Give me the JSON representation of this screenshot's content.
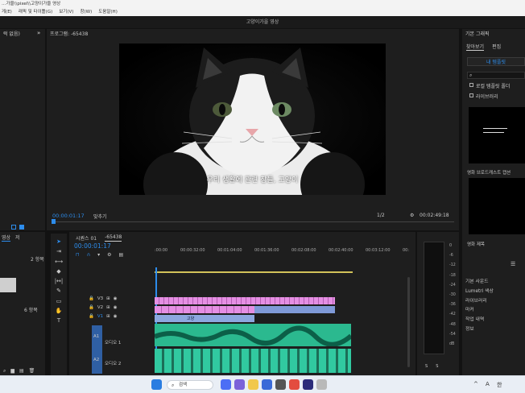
{
  "window": {
    "title": "…가을\\\\pixel\\\\고양이가을 영상"
  },
  "menu": [
    "편집(E)",
    "클립(C)",
    "시퀀스(S)",
    "표식(M)",
    "그래픽 및 타이틀(G)",
    "보기(V)",
    "창(W)",
    "도움말(H)"
  ],
  "menu_visible": [
    "게(E)",
    "래픽 및 타이틀(G)",
    "보기(V)",
    "창(W)",
    "도움말(H)"
  ],
  "app_header": {
    "title": "고양이가을 영상"
  },
  "source_panel": {
    "tab": "럭 없음)"
  },
  "program_monitor": {
    "tab": "프로그램: -65438",
    "subtitle": "우리 생활에 관련 창들, 고양이",
    "timecode_current": "00:00:01:17",
    "fit_label": "맞추기",
    "quality": "1/2",
    "timecode_total": "00:02:49:18"
  },
  "essential_graphics": {
    "title": "기본 그래픽",
    "tabs": [
      "찾아보기",
      "편집"
    ],
    "my_templates_button": "내 템플릿",
    "checkbox_local": "로컬 템플릿 폴더",
    "checkbox_library": "라이브러리",
    "card_caption_1": "영화 브로드캐스트 캡션",
    "card_caption_2": "영화 제목"
  },
  "right_panels": [
    "기본 사운드",
    "Lumetri 색상",
    "라이브러리",
    "마커",
    "작업 내역",
    "정보"
  ],
  "project_panel": {
    "tab_project": "영상",
    "tab_other": "저",
    "count_1": "2 항목",
    "count_2": "6 항목"
  },
  "timeline": {
    "tab_seq1": "시퀀스 01",
    "tab_seq2": "-65438",
    "timecode": "00:00:01:17",
    "ruler": [
      ":00:00",
      "00:00:32:00",
      "00:01:04:00",
      "00:01:36:00",
      "00:02:08:00",
      "00:02:40:00",
      "00:03:12:00",
      "00:"
    ],
    "tracks_video": [
      "V3",
      "V2",
      "V1"
    ],
    "tracks_audio": [
      "A1",
      "A2"
    ],
    "audio_label_1": "오디오 1",
    "audio_label_2": "오디오 2",
    "clip_v1_label": "고양"
  },
  "meter": {
    "scale": [
      "0",
      "-6",
      "-12",
      "-18",
      "-24",
      "-30",
      "-36",
      "-42",
      "-48",
      "-54",
      "dB"
    ],
    "solo": [
      "S",
      "S"
    ]
  },
  "taskbar": {
    "search": "검색",
    "ime": "A",
    "lang": "한"
  },
  "colors": {
    "accent": "#2d8ceb",
    "pink_clip": "#e58fe3",
    "video_clip": "#8da8e0",
    "audio_clip": "#31c9a0"
  }
}
